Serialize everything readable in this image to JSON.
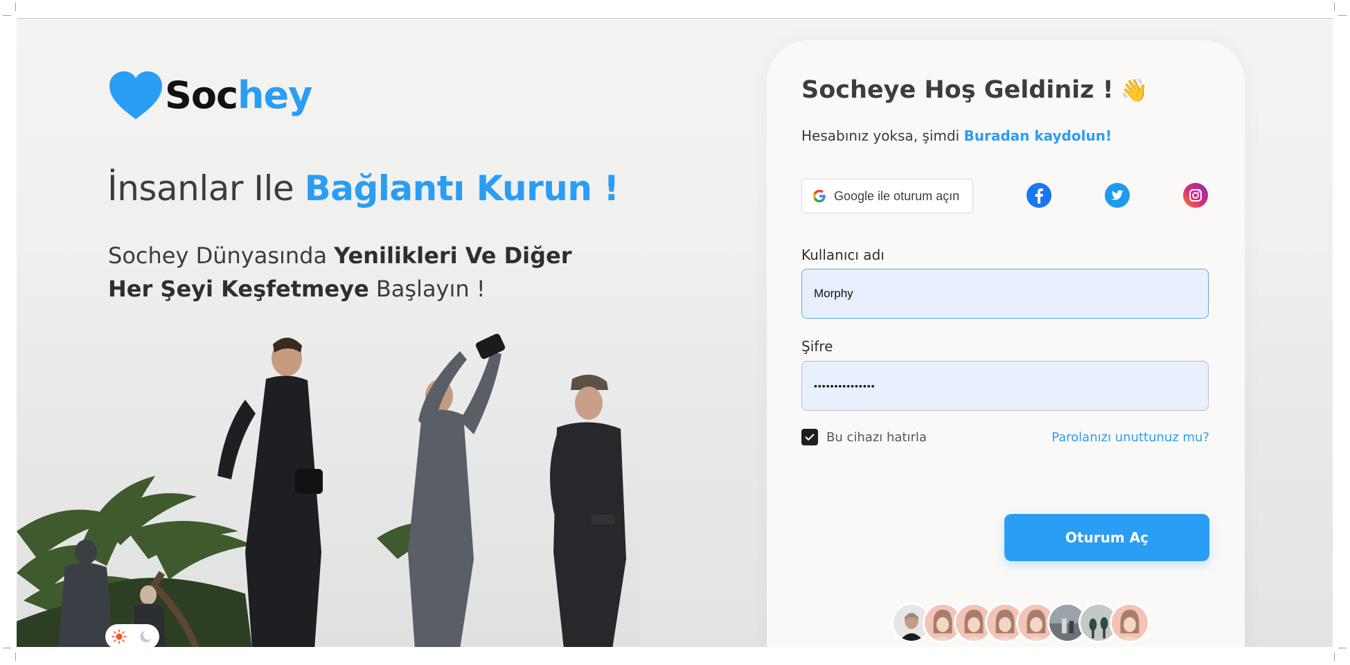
{
  "brand": {
    "name_part1": "Soc",
    "name_part2": "hey",
    "accent_color": "#2a9df4"
  },
  "hero": {
    "title_plain": "İnsanlar Ile ",
    "title_accent": "Bağlantı Kurun !",
    "subtitle_part1": "Sochey Dünyasında ",
    "subtitle_bold1": "Yenilikleri Ve Diğer Her Şeyi Keşfetmeye",
    "subtitle_part2": " Başlayın !"
  },
  "login": {
    "welcome": "Socheye Hoş Geldiniz !",
    "wave_emoji": "👋",
    "signup_prompt": "Hesabınız yoksa, şimdi ",
    "signup_link": "Buradan kaydolun!",
    "google_button": "Google ile oturum açın",
    "social_icons": [
      "facebook-icon",
      "twitter-icon",
      "instagram-icon"
    ],
    "username_label": "Kullanıcı adı",
    "username_value": "Morphy",
    "password_label": "Şifre",
    "password_value": "•••••••••••••••",
    "remember_label": "Bu cihazı hatırla",
    "remember_checked": true,
    "forgot_link": "Parolanızı unuttunuz mu?",
    "submit_label": "Oturum Aç"
  },
  "avatars": [
    "photo-avatar",
    "memoji-avatar",
    "memoji-avatar",
    "memoji-avatar",
    "memoji-avatar",
    "photo-avatar",
    "photo-avatar",
    "memoji-avatar"
  ],
  "theme_toggle": {
    "light_icon": "sun-icon",
    "dark_icon": "moon-icon"
  }
}
